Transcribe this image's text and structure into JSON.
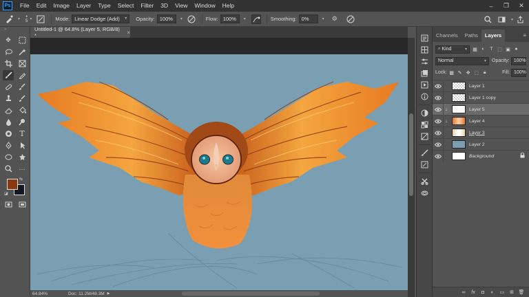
{
  "menubar": {
    "logo": "Ps",
    "items": [
      "File",
      "Edit",
      "Image",
      "Layer",
      "Type",
      "Select",
      "Filter",
      "3D",
      "View",
      "Window",
      "Help"
    ]
  },
  "options": {
    "brush_size": "5",
    "mode_label": "Mode:",
    "mode_value": "Linear Dodge (Add)",
    "opacity_label": "Opacity:",
    "opacity_value": "100%",
    "flow_label": "Flow:",
    "flow_value": "100%",
    "smoothing_label": "Smoothing:",
    "smoothing_value": "0%"
  },
  "document": {
    "tab_title": "Untitled-1 @ 64.8% (Layer 5, RGB/8) *",
    "tab_close": "×"
  },
  "status": {
    "zoom": "64.84%",
    "doc_size": "Doc: 11.2M/48.3M"
  },
  "colors": {
    "foreground": "#8a3812",
    "background": "#111820",
    "canvas": "#7b9fb2",
    "layer2_swatch": "#7b9fb2"
  },
  "panel": {
    "tabs": [
      "Channels",
      "Paths",
      "Layers"
    ],
    "active_tab": "Layers",
    "filter_label": "Kind",
    "blend_mode": "Normal",
    "opacity_label": "Opacity:",
    "opacity_value": "100%",
    "lock_label": "Lock:",
    "fill_label": "Fill:",
    "fill_value": "100%"
  },
  "layers": [
    {
      "name": "Layer 1",
      "thumb": "transparent",
      "visible": true,
      "selected": false,
      "clipped": false,
      "locked": false
    },
    {
      "name": "Layer 1 copy",
      "thumb": "transparent",
      "visible": true,
      "selected": false,
      "clipped": false,
      "locked": false
    },
    {
      "name": "Layer 5",
      "thumb": "owl-sketch",
      "visible": true,
      "selected": true,
      "clipped": true,
      "locked": false
    },
    {
      "name": "Layer 4",
      "thumb": "owl-orange",
      "visible": true,
      "selected": false,
      "clipped": true,
      "locked": false
    },
    {
      "name": "Layer 3",
      "thumb": "owl-outline",
      "visible": true,
      "selected": false,
      "clipped": false,
      "locked": false
    },
    {
      "name": "Layer 2",
      "thumb": "blue",
      "visible": true,
      "selected": false,
      "clipped": false,
      "locked": false
    },
    {
      "name": "Background",
      "thumb": "white",
      "visible": true,
      "selected": false,
      "clipped": false,
      "locked": true
    }
  ]
}
